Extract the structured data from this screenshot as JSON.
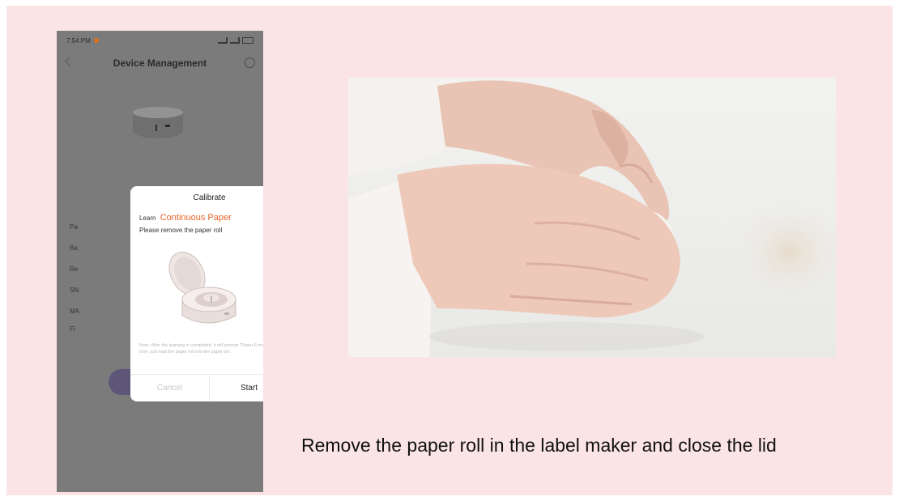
{
  "phone": {
    "status_time": "7:54 PM",
    "nav_title": "Device Management",
    "background_labels": [
      "Pa",
      "Ba",
      "Re",
      "SN",
      "MA",
      "Fi"
    ]
  },
  "dialog": {
    "title": "Calibrate",
    "learn_prefix": "Learn",
    "paper_type": "Continuous Paper",
    "instruction": "Please remove the paper roll",
    "note": "Note: After the learning is completed, it will prompt \"Paper Error\". At this time, just load the paper roll into the paper bin.",
    "cancel_label": "Cancel",
    "start_label": "Start"
  },
  "caption": "Remove the paper roll in the label maker and close the lid",
  "colors": {
    "slide_background": "#fbe4e6",
    "accent": "#e8642a",
    "phone_dim": "#7b7b7b",
    "bg_button": "#5e5679"
  },
  "icons": [
    "back-icon",
    "settings-icon",
    "battery-icon",
    "signal-icon"
  ]
}
